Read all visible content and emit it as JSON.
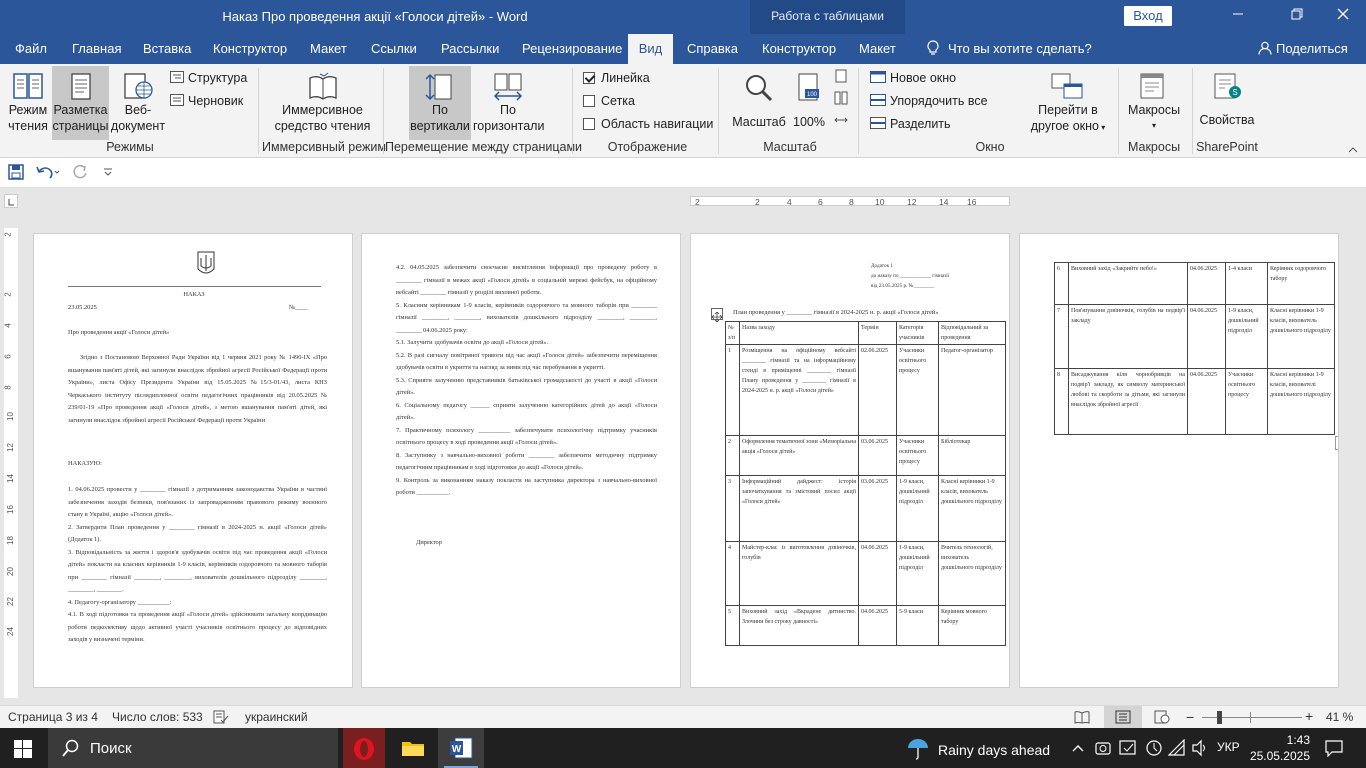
{
  "titlebar": {
    "title": "Наказ Про проведення акції «Голоси дітей»  -  Word",
    "table_tools": "Работа с таблицами",
    "signin": "Вход"
  },
  "menu": [
    "Файл",
    "Главная",
    "Вставка",
    "Конструктор",
    "Макет",
    "Ссылки",
    "Рассылки",
    "Рецензирование",
    "Вид",
    "Справка",
    "Конструктор",
    "Макет"
  ],
  "menu_search": "Что вы хотите сделать?",
  "share": "Поделиться",
  "ribbon": {
    "views": {
      "read_1": "Режим",
      "read_2": "чтения",
      "print_1": "Разметка",
      "print_2": "страницы",
      "web_1": "Веб-",
      "web_2": "документ",
      "structure": "Структура",
      "draft": "Черновик",
      "group": "Режимы"
    },
    "immersive": {
      "reader_1": "Иммерсивное",
      "reader_2": "средство чтения",
      "group": "Иммерсивный режим"
    },
    "movement": {
      "vertical_1": "По",
      "vertical_2": "вертикали",
      "side_1": "По",
      "side_2": "горизонтали",
      "group": "Перемещение между страницами"
    },
    "show": {
      "ruler": "Линейка",
      "grid": "Сетка",
      "nav": "Область навигации",
      "group": "Отображение"
    },
    "zoom": {
      "zoom": "Масштаб",
      "percent": "100%",
      "group": "Масштаб"
    },
    "window": {
      "new": "Новое окно",
      "arrange": "Упорядочить все",
      "split": "Разделить",
      "switch_1": "Перейти в",
      "switch_2": "другое окно",
      "group": "Окно"
    },
    "macros": {
      "label": "Макросы",
      "group": "Макросы"
    },
    "sharepoint": {
      "label": "Свойства",
      "group": "SharePoint"
    }
  },
  "ruler_h": [
    "2",
    "2",
    "4",
    "6",
    "8",
    "10",
    "12",
    "14",
    "16"
  ],
  "ruler_v": [
    "2",
    "2",
    "4",
    "6",
    "8",
    "10",
    "12",
    "14",
    "16",
    "18",
    "20",
    "22",
    "24"
  ],
  "page1": {
    "nakaz": "НАКАЗ",
    "date": "23.05.2025",
    "num": "№____",
    "subject": "Про проведення акції «Голоси дітей»",
    "preamble": "Згідно з Постановою Верховної Ради України від 1 червня 2021 року № 1490-IX «Про вшанування пам'яті дітей, які загинули внаслідок збройної агресії Російської Федерації проти України», листа Офісу Президента України від 15.05.2025 №15/3-01/43, листа КНЗ Черкаського інституту післядипломної освіти педагогічних працівників від 20.05.2025 № 239/01-19 «Про проведення акції «Голоси дітей», з метою вшанування пам'яті дітей, які загинули внаслідок збройної агресії Російської Федерації проти України",
    "order": "НАКАЗУЮ:",
    "body": "1. 04.06.2025 провести у ________ гімназії з дотриманням законодавства України в частині забезпечення заходів безпеки, пов'язаних із запровадженням правового режиму воєнного стану в Україні, акцію «Голоси дітей».\n2. Затвердити План проведення у ________ гімназії в 2024-2025 н. акції «Голоси дітей» (Додаток 1).\n3. Відповідальність за життя і здоров'я здобувачів освіти під час проведення акції «Голоси дітей» покласти на класних керівників 1-9 класів, керівників оздоровчого та мовного таборів при ________ гімназії ________, ________, вихователів дошкільного підрозділу ________, ________, ________.\n4. Педагогу-організатору __________:\n4.1. В ході підготовки та проведення акції «Голоси дітей» здійснювати загальну координацію роботи педколективу щодо активної участі учасників освітнього процесу до відповідних заходів у визначені терміни."
  },
  "page2": {
    "body": "4.2. 04.05.2025 забезпечити своєчасне висвітлення інформації про проведену роботу в ________ гімназії в межах акції «Голоси дітей» в соціальній мережі фейсбук, на офіційному вебсайті ________ гімназії у розділі виховної роботи.\n5. Класним керівникам 1-9 класів, керівників оздоровчого та мовного таборів при ________ гімназії ________, ________, вихователів дошкільного підрозділу ________, ________, ________ 04.06.2025 року:\n5.1. Залучити здобувачів освіти до акції «Голоси дітей».\n5.2. В разі сигналу повітряної тривоги під час акції «Голоси дітей» забезпечити переміщення здобувачів освіти в укриття та нагляд за ними під час перебування в укритті.\n5.3. Сприяти залученню представників батьківської громадськості до участі в акції «Голоси дітей».\n6. Соціальному педагогу ______ сприяти залученню категорійних дітей до акції «Голоси дітей».\n7. Практичному психологу __________ забезпечувати психологічну підтримку учасників освітнього процесу в ході проведення акції «Голоси дітей».\n8. Заступнику з навчально-виховної роботи ________ забезпечити методичну підтримку педагогічним працівникам в ході підготовки до акції «Голоси дітей».\n9. Контроль за виконанням наказу покласти на заступника директора з навчально-виховної роботи __________.",
    "director": "Директор"
  },
  "page3": {
    "addendum_1": "Додаток 1",
    "addendum_2": "до наказу по ____________ гімназії",
    "addendum_3": "від 23.05.2025 р. №________",
    "plan_title": "План проведення у ________ гімназії в 2024-2025 н. р. акції «Голоси дітей»",
    "headers": [
      "№ з/п",
      "Назва заходу",
      "Термін",
      "Категорія учасників",
      "Відповідальний за проведення"
    ],
    "rows": [
      [
        "1",
        "Розміщення на офіційному вебсайті ________ гімназії та на інформаційному стенді в приміщенні ________ гімназії Плану проведення у ________ гімназії в 2024-2025 н. р. акції «Голоси дітей»",
        "02.06.2025",
        "Учасники освітнього процесу",
        "Педагог-організатор"
      ],
      [
        "2",
        "Оформлення тематичної зони «Меморіальна акція «Голоси дітей»",
        "03.06.2025",
        "Учасники освітнього процесу",
        "Бібліотекар"
      ],
      [
        "3",
        "Інформаційний дайджест: історія започаткування та змістовий посил акції «Голоси дітей»",
        "03.06.2025",
        "1-9 класи, дошкільний підрозділ",
        "Класні керівники 1-9 класів, вихователь дошкільного підрозділу"
      ],
      [
        "4",
        "Майстер-клас із виготовлення дзвіночків, голубів",
        "04.06.2025",
        "1-9 класи, дошкільний підрозділ",
        "Вчитель технологій, вихователь дошкільного підрозділу"
      ],
      [
        "5",
        "Виховний захід «Вкрадене дитинство. Злочини без строку давності»",
        "04.06.2025",
        "5-9 класи",
        "Керівник мовного табору"
      ]
    ]
  },
  "page4": {
    "rows": [
      [
        "6",
        "Виховний захід «Закрийте небо!»",
        "04.06.2025",
        "1-4 класи",
        "Керівник оздоровчого табору"
      ],
      [
        "7",
        "Пов'язування дзвіночків, голубів на подвір'ї закладу",
        "04.06.2025",
        "1-9 класи, дошкільний підрозділ",
        "Класні керівники 1-9 класів, вихователь дошкільного підрозділу"
      ],
      [
        "8",
        "Висаджування кілн чорнобривців на подвір'ї закладу, як символу материнської любові та скорботи за дітьми, які загинули внаслідок збройної агресії",
        "04.06.2025",
        "Учасники освітнього процесу",
        "Класні керівники 1-9 класів, вихователі дошкільного підрозділу"
      ]
    ]
  },
  "status": {
    "page": "Страница 3 из 4",
    "words": "Число слов: 533",
    "lang": "украинский",
    "zoom": "41 %"
  },
  "taskbar": {
    "search": "Поиск",
    "weather": "Rainy days ahead",
    "lang": "УКР",
    "time": "1:43",
    "date": "25.05.2025"
  },
  "colors": {
    "accent": "#2b579a",
    "ribbon": "#f3f3f3",
    "taskbar": "#202020",
    "opera": "#e0141e",
    "word": "#2b579a"
  }
}
